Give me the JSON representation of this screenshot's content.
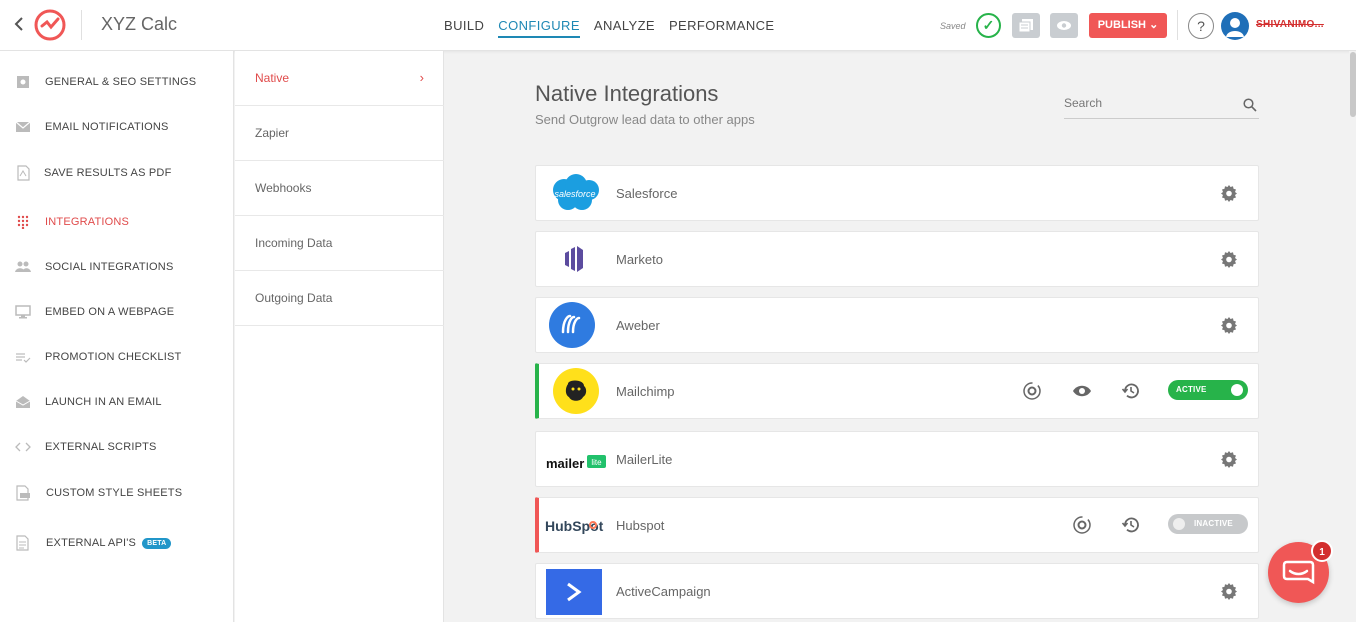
{
  "app": {
    "title": "XYZ Calc",
    "back_icon": "chevron-left-icon"
  },
  "nav": {
    "tabs": [
      {
        "label": "BUILD",
        "active": false
      },
      {
        "label": "CONFIGURE",
        "active": true
      },
      {
        "label": "ANALYZE",
        "active": false
      },
      {
        "label": "PERFORMANCE",
        "active": false
      }
    ]
  },
  "status": {
    "saved_label": "Saved",
    "check_icon": "checkmark-circle-icon"
  },
  "actions": {
    "publish_label": "PUBLISH",
    "help_label": "?",
    "username": "SHIVANIMO..."
  },
  "sidebar": {
    "items": [
      {
        "label": "GENERAL & SEO SETTINGS",
        "icon": "settings-square-icon"
      },
      {
        "label": "EMAIL NOTIFICATIONS",
        "icon": "envelope-icon"
      },
      {
        "label": "SAVE RESULTS AS PDF",
        "icon": "pdf-icon"
      },
      {
        "label": "INTEGRATIONS",
        "icon": "grid-dots-icon",
        "active": true
      },
      {
        "label": "SOCIAL INTEGRATIONS",
        "icon": "people-icon"
      },
      {
        "label": "EMBED ON A WEBPAGE",
        "icon": "monitor-icon"
      },
      {
        "label": "PROMOTION CHECKLIST",
        "icon": "checklist-icon"
      },
      {
        "label": "LAUNCH IN AN EMAIL",
        "icon": "open-envelope-icon"
      },
      {
        "label": "EXTERNAL SCRIPTS",
        "icon": "code-icon"
      },
      {
        "label": "CUSTOM STYLE SHEETS",
        "icon": "css-file-icon"
      },
      {
        "label": "EXTERNAL API'S",
        "icon": "api-file-icon",
        "badge": "BETA"
      }
    ]
  },
  "subnav": {
    "items": [
      {
        "label": "Native",
        "active": true
      },
      {
        "label": "Zapier"
      },
      {
        "label": "Webhooks"
      },
      {
        "label": "Incoming Data"
      },
      {
        "label": "Outgoing Data"
      }
    ]
  },
  "main": {
    "title": "Native Integrations",
    "subtitle": "Send Outgrow lead data to other apps",
    "search": {
      "placeholder": "Search",
      "value": ""
    },
    "integrations": [
      {
        "name": "Salesforce",
        "logo_text": "salesforce",
        "state": "none"
      },
      {
        "name": "Marketo",
        "state": "none"
      },
      {
        "name": "Aweber",
        "state": "none"
      },
      {
        "name": "Mailchimp",
        "state": "active",
        "toggle_label": "ACTIVE"
      },
      {
        "name": "MailerLite",
        "logo_text": "mailer",
        "logo_badge": "lite",
        "state": "none"
      },
      {
        "name": "Hubspot",
        "logo_text": "HubSpot",
        "state": "inactive",
        "toggle_label": "INACTIVE"
      },
      {
        "name": "ActiveCampaign",
        "state": "none"
      }
    ]
  },
  "chat": {
    "badge_count": "1"
  },
  "colors": {
    "accent": "#1e88b4",
    "brand_red": "#f05756",
    "active_green": "#27b34a"
  }
}
